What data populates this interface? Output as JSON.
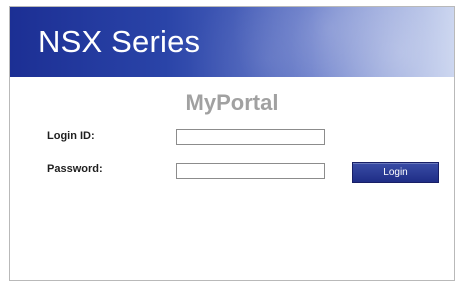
{
  "header": {
    "title": "NSX Series"
  },
  "portal": {
    "title": "MyPortal"
  },
  "form": {
    "login_id_label": "Login ID:",
    "password_label": "Password:",
    "login_id_value": "",
    "password_value": "",
    "login_button_label": "Login"
  },
  "colors": {
    "banner_primary": "#1c2f94",
    "banner_secondary": "#c7d2ee",
    "portal_title": "#a1a1a1",
    "button": "#2a3b97"
  }
}
